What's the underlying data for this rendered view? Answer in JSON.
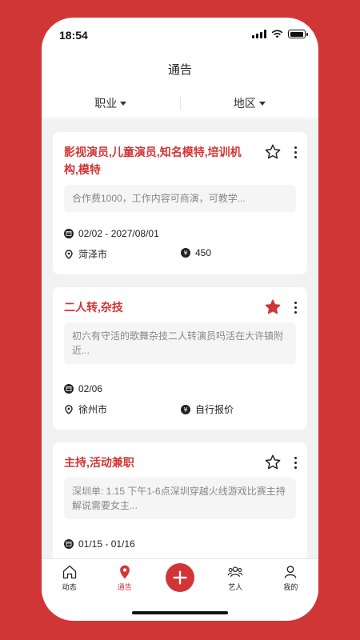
{
  "status": {
    "time": "18:54"
  },
  "header": {
    "title": "通告"
  },
  "filters": [
    {
      "label": "职业"
    },
    {
      "label": "地区"
    }
  ],
  "cards": [
    {
      "title": "影视演员,儿童演员,知名模特,培训机构,模特",
      "desc": "合作费1000，工作内容可商演，可教学...",
      "date": "02/02 - 2027/08/01",
      "location": "菏泽市",
      "price": "450",
      "starred": false
    },
    {
      "title": "二人转,杂技",
      "desc": "初六有守活的歌舞杂技二人转演员吗活在大许镇附近...",
      "date": "02/06",
      "location": "徐州市",
      "price": "自行报价",
      "starred": true
    },
    {
      "title": "主持,活动兼职",
      "desc": "深圳单: 1.15 下午1-6点深圳穿越火线游戏比赛主持解说需要女主...",
      "date": "01/15 - 01/16",
      "starred": false
    }
  ],
  "tabbar": {
    "items": [
      {
        "label": "动态",
        "icon": "home-icon"
      },
      {
        "label": "通告",
        "icon": "location-pin-icon",
        "active": true
      },
      {
        "label": "",
        "icon": "plus-icon"
      },
      {
        "label": "艺人",
        "icon": "people-icon"
      },
      {
        "label": "我的",
        "icon": "user-icon"
      }
    ]
  },
  "colors": {
    "accent": "#d13636",
    "background": "#f2f2f2"
  }
}
